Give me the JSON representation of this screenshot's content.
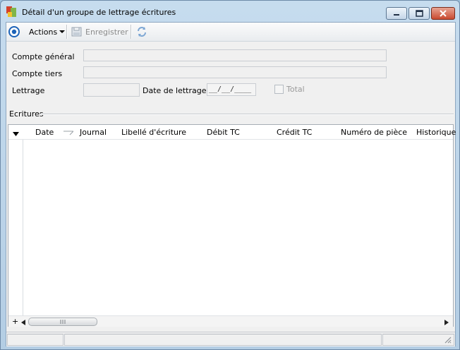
{
  "window": {
    "title": "Détail d'un groupe de lettrage écritures"
  },
  "toolbar": {
    "actions_label": "Actions",
    "save_label": "Enregistrer"
  },
  "form": {
    "compte_general_label": "Compte général",
    "compte_tiers_label": "Compte tiers",
    "lettrage_label": "Lettrage",
    "date_lettrage_label": "Date de lettrage",
    "date_placeholder": "__/__/____",
    "total_label": "Total"
  },
  "ecritures": {
    "group_label": "Ecritures",
    "columns": [
      "Date",
      "Journal",
      "Libellé d'écriture",
      "Débit TC",
      "Crédit TC",
      "Numéro de pièce",
      "Historique"
    ],
    "add_symbol": "+"
  }
}
